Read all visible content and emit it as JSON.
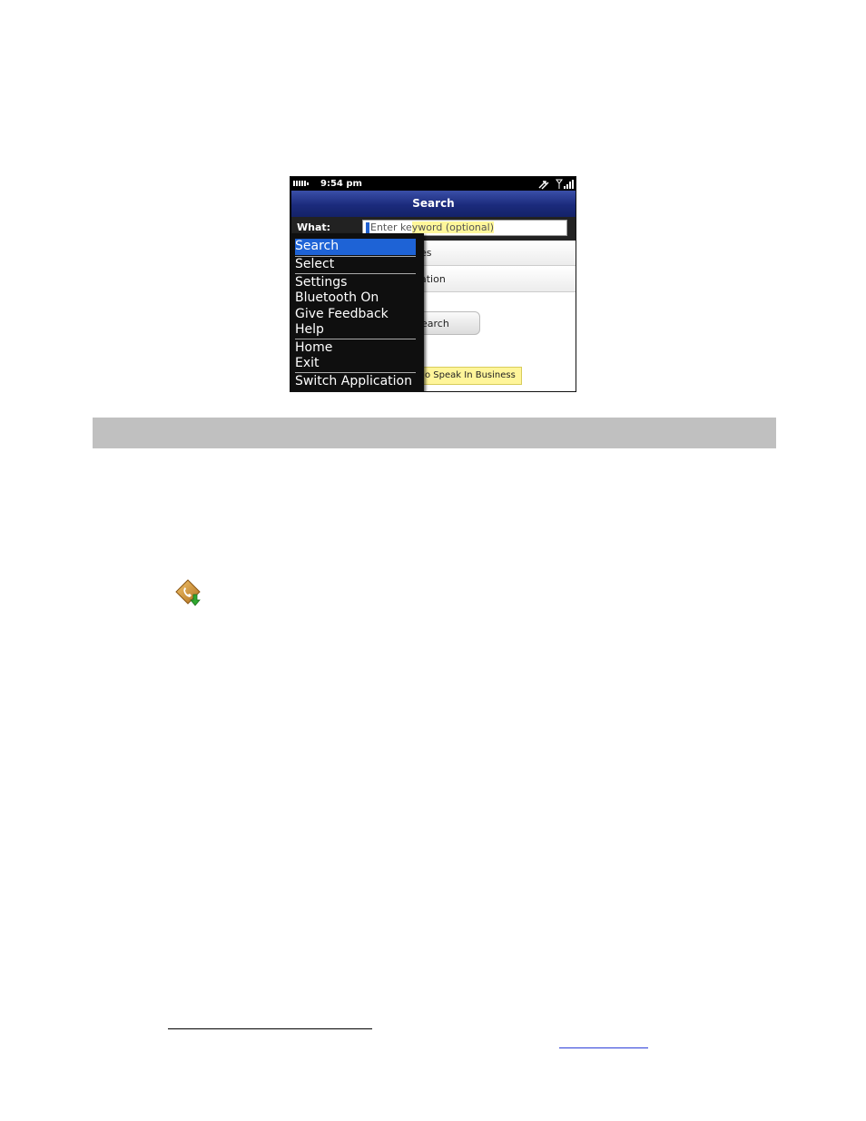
{
  "status_bar": {
    "time": "9:54 pm",
    "battery_icon": "battery-icon",
    "data_icon": "data-arrows-icon",
    "signal_icon": "signal-strength-icon"
  },
  "screen": {
    "title": "Search",
    "what_label": "What:",
    "keyword_input": {
      "placeholder": "Enter keyword (optional)",
      "visible_left": "Enter ke",
      "visible_right": "yword (optional)"
    },
    "rows": {
      "categories_fragment": "es",
      "location_fragment": "ation"
    },
    "search_button_fragment": "earch",
    "banner_fragment": "o Speak In Business"
  },
  "menu": {
    "items": [
      {
        "label": "Search",
        "selected": true
      },
      {
        "label": "Select"
      },
      {
        "label": "Settings"
      },
      {
        "label": "Bluetooth On"
      },
      {
        "label": "Give Feedback"
      },
      {
        "label": "Help"
      },
      {
        "label": "Home"
      },
      {
        "label": "Exit"
      },
      {
        "label": "Switch Application"
      }
    ]
  },
  "page": {
    "app_icon": "phone-download-app-icon"
  },
  "colors": {
    "title_bar": "#1b2b7c",
    "menu_selection": "#1e63d6",
    "menu_background": "#0f0f0f",
    "highlight_yellow": "#fff59a",
    "band_gray": "#c0c0c0"
  }
}
